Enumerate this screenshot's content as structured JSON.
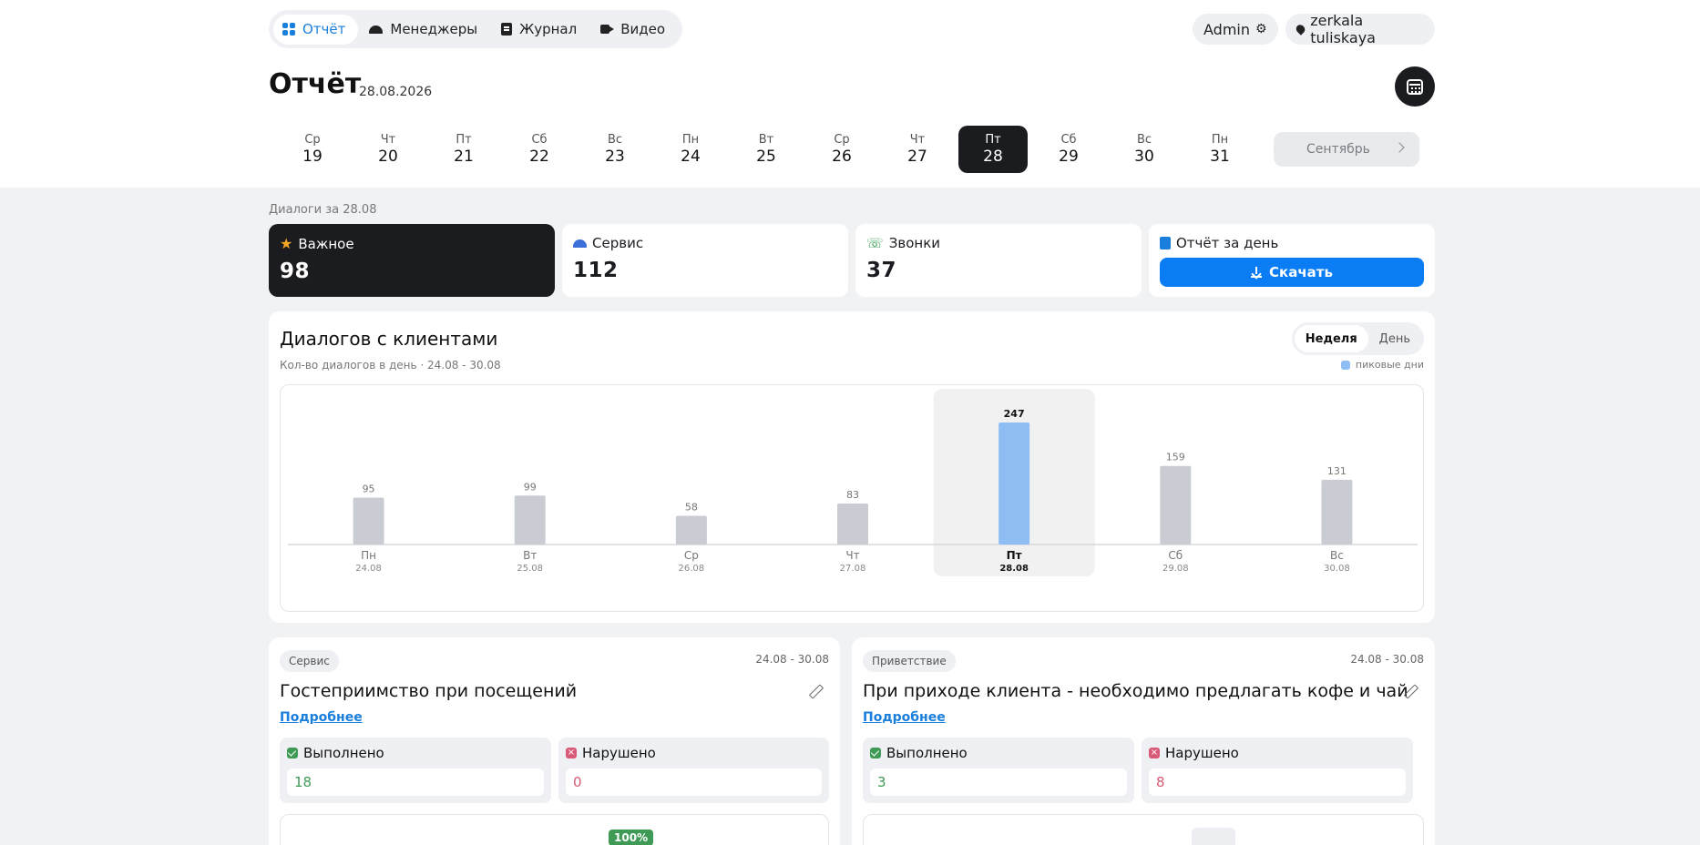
{
  "nav": {
    "items": [
      {
        "label": "Отчёт",
        "active": true,
        "icon": "grid-icon"
      },
      {
        "label": "Менеджеры",
        "active": false,
        "icon": "dome-icon"
      },
      {
        "label": "Журнал",
        "active": false,
        "icon": "book-icon"
      },
      {
        "label": "Видео",
        "active": false,
        "icon": "video-icon"
      }
    ],
    "admin_label": "Admin",
    "location_label": "zerkala tuliskaya"
  },
  "header": {
    "title": "Отчёт",
    "date": "28.08.2026"
  },
  "days": [
    {
      "dn": "Ср",
      "dd": "19"
    },
    {
      "dn": "Чт",
      "dd": "20"
    },
    {
      "dn": "Пт",
      "dd": "21"
    },
    {
      "dn": "Сб",
      "dd": "22"
    },
    {
      "dn": "Вс",
      "dd": "23"
    },
    {
      "dn": "Пн",
      "dd": "24"
    },
    {
      "dn": "Вт",
      "dd": "25"
    },
    {
      "dn": "Ср",
      "dd": "26"
    },
    {
      "dn": "Чт",
      "dd": "27"
    },
    {
      "dn": "Пт",
      "dd": "28",
      "selected": true
    },
    {
      "dn": "Сб",
      "dd": "29"
    },
    {
      "dn": "Вс",
      "dd": "30"
    },
    {
      "dn": "Пн",
      "dd": "31"
    }
  ],
  "month_button": "Сентябрь",
  "dialogs_label": "Диалоги за 28.08",
  "stats": {
    "important": {
      "label": "Важное",
      "value": "98"
    },
    "service": {
      "label": "Сервис",
      "value": "112"
    },
    "calls": {
      "label": "Звонки",
      "value": "37"
    },
    "report": {
      "label": "Отчёт за день",
      "button": "Скачать"
    }
  },
  "chart": {
    "title": "Диалогов с клиентами",
    "subtitle": "Кол-во диалогов в день · 24.08 - 30.08",
    "toggle": [
      "Неделя",
      "День"
    ],
    "legend": "пиковые дни",
    "colors": {
      "normal": "#c9cdd3",
      "peak": "#8dbdf2",
      "highlight": "#f1f1f1"
    }
  },
  "chart_data": {
    "type": "bar",
    "categories": [
      "Пн",
      "Вт",
      "Ср",
      "Чт",
      "Пт",
      "Сб",
      "Вс"
    ],
    "dates": [
      "24.08",
      "25.08",
      "26.08",
      "27.08",
      "28.08",
      "29.08",
      "30.08"
    ],
    "values": [
      95,
      99,
      58,
      83,
      247,
      159,
      131
    ],
    "peak_index": 4,
    "highlight_index": 4,
    "title": "Диалогов с клиентами",
    "ylim": [
      0,
      247
    ],
    "grid": false
  },
  "cards": [
    {
      "tag": "Сервис",
      "range": "24.08 - 30.08",
      "title": "Гостеприимство при посещений",
      "more": "Подробнее",
      "done_label": "Выполнено",
      "done_value": "18",
      "bad_label": "Нарушено",
      "bad_value": "0",
      "percent": "100%"
    },
    {
      "tag": "Приветствие",
      "range": "24.08 - 30.08",
      "title": "При приходе клиента - необходимо предлагать кофе и чай",
      "more": "Подробнее",
      "done_label": "Выполнено",
      "done_value": "3",
      "bad_label": "Нарушено",
      "bad_value": "8"
    }
  ]
}
